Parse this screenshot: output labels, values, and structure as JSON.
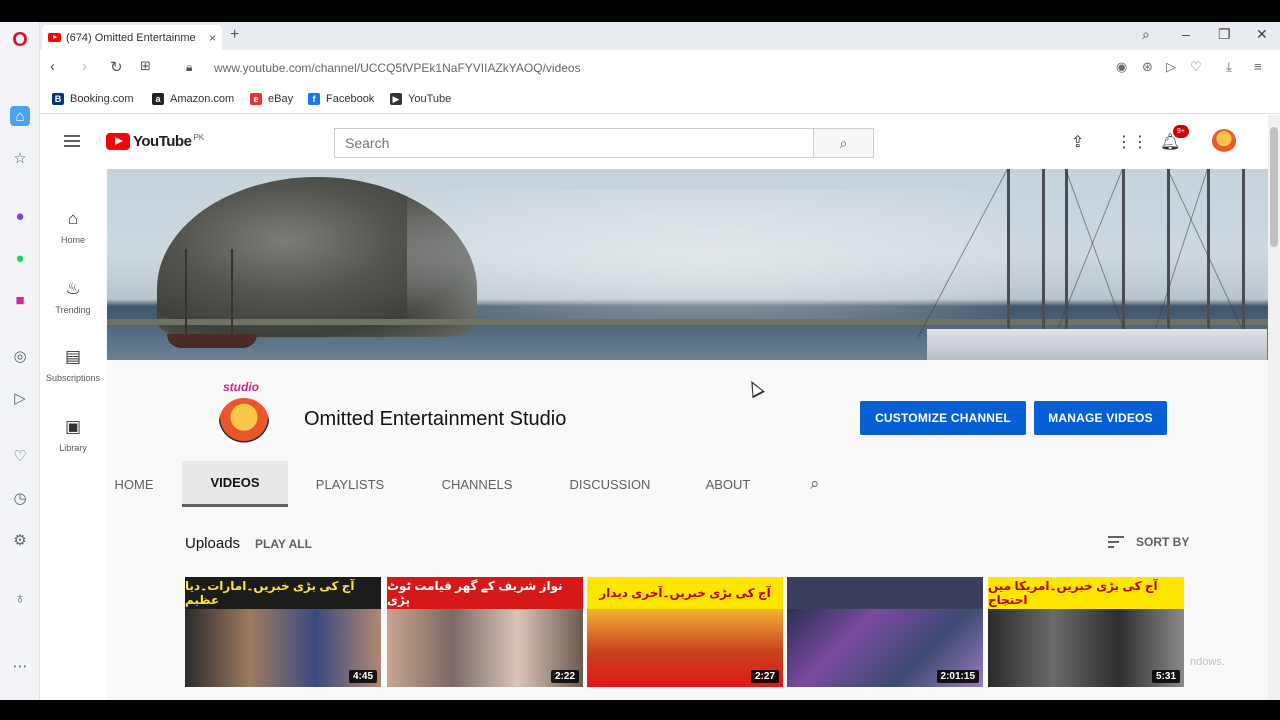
{
  "browser": {
    "tab_title": "(674) Omitted Entertainme",
    "tab_close": "×",
    "new_tab": "+",
    "url": "www.youtube.com/channel/UCCQ5fVPEk1NaFYVIIAZkYAOQ/videos",
    "bookmarks": [
      {
        "label": "Booking.com",
        "color": "#003580",
        "glyph": "B"
      },
      {
        "label": "Amazon.com",
        "color": "#222222",
        "glyph": "a"
      },
      {
        "label": "eBay",
        "color": "#e53238",
        "glyph": "e"
      },
      {
        "label": "Facebook",
        "color": "#1877f2",
        "glyph": "f"
      },
      {
        "label": "YouTube",
        "color": "#333333",
        "glyph": "▶"
      }
    ]
  },
  "youtube": {
    "logo_text": "YouTube",
    "logo_country": "PK",
    "search_placeholder": "Search",
    "notification_count": "9+",
    "guide": [
      {
        "label": "Home",
        "icon": "home-icon",
        "glyph": "⌂"
      },
      {
        "label": "Trending",
        "icon": "trending-icon",
        "glyph": "♨"
      },
      {
        "label": "Subscriptions",
        "icon": "subscriptions-icon",
        "glyph": "▤"
      },
      {
        "label": "Library",
        "icon": "library-icon",
        "glyph": "▣"
      }
    ]
  },
  "channel": {
    "avatar_text": "studio",
    "name": "Omitted Entertainment Studio",
    "customize_label": "CUSTOMIZE CHANNEL",
    "manage_label": "MANAGE VIDEOS",
    "tabs": [
      "HOME",
      "VIDEOS",
      "PLAYLISTS",
      "CHANNELS",
      "DISCUSSION",
      "ABOUT"
    ],
    "active_tab": "VIDEOS"
  },
  "uploads": {
    "title": "Uploads",
    "play_all": "PLAY ALL",
    "sort_by": "SORT BY",
    "videos": [
      {
        "headline": "آج کی بڑی خبریں۔امارات۔دیا عظیم",
        "duration": "4:45",
        "top_bg": "#1c1c1c",
        "top_color": "#ffe23a",
        "body_bg": "#6b4c3b"
      },
      {
        "headline": "نواز شریف کے گھر قیامت ٹوٹ پڑی",
        "duration": "2:22",
        "top_bg": "#d71818",
        "top_color": "#ffffff",
        "body_bg": "#8a6a5a"
      },
      {
        "headline": "آج کی بڑی خبریں۔آخری دیدار",
        "duration": "2:27",
        "top_bg": "#ffe600",
        "top_color": "#c00000",
        "body_bg": "#9b3020"
      },
      {
        "headline": "",
        "duration": "2:01:15",
        "top_bg": "#3a3f5c",
        "top_color": "#ffffff",
        "body_bg": "#4a4f78"
      },
      {
        "headline": "آج کی بڑی خبریں۔امریکا میں احتجاج",
        "duration": "5:31",
        "top_bg": "#ffe600",
        "top_color": "#c00000",
        "body_bg": "#3a3a3a"
      }
    ]
  },
  "watermark": "ndows."
}
